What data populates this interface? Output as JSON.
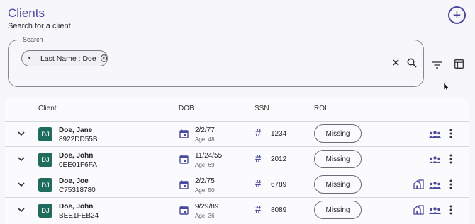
{
  "header": {
    "title": "Clients",
    "subtitle": "Search for a client"
  },
  "search": {
    "legend": "Search",
    "chip_label": "Last Name : Doe"
  },
  "table": {
    "columns": [
      "Client",
      "DOB",
      "SSN",
      "ROI"
    ],
    "rows": [
      {
        "initials": "DJ",
        "name": "Doe, Jane",
        "id": "8922DD55B",
        "dob": "2/2/77",
        "age": "Age: 48",
        "ssn": "1234",
        "roi": "Missing",
        "show_house": false
      },
      {
        "initials": "DJ",
        "name": "Doe, John",
        "id": "0EE01F6FA",
        "dob": "11/24/55",
        "age": "Age: 69",
        "ssn": "2012",
        "roi": "Missing",
        "show_house": false
      },
      {
        "initials": "DJ",
        "name": "Doe, Joe",
        "id": "C75318780",
        "dob": "2/2/75",
        "age": "Age: 50",
        "ssn": "6789",
        "roi": "Missing",
        "show_house": true
      },
      {
        "initials": "DJ",
        "name": "Doe, John",
        "id": "BEE1FEB24",
        "dob": "9/29/89",
        "age": "Age: 36",
        "ssn": "8089",
        "roi": "Missing",
        "show_house": true
      }
    ]
  },
  "colors": {
    "accent": "#4a4a9c",
    "avatar": "#1f6b5e"
  }
}
